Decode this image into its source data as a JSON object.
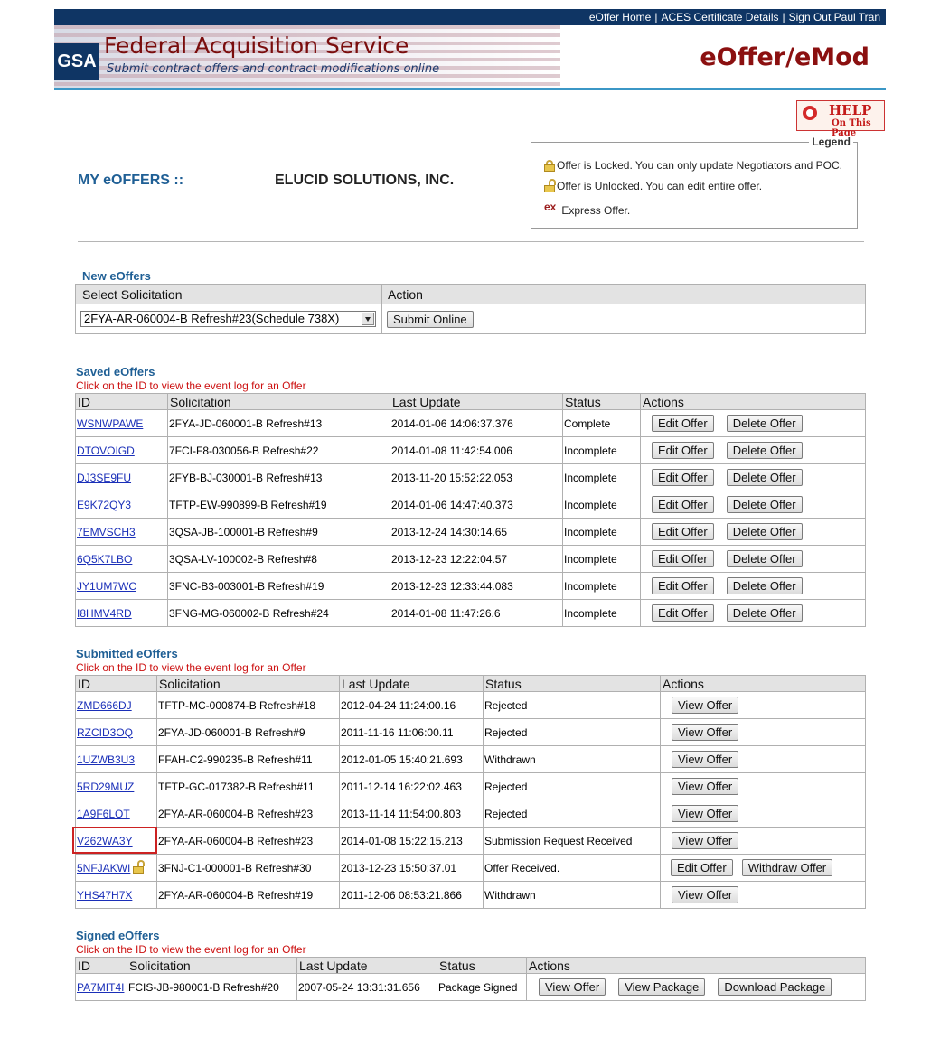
{
  "topnav": {
    "home": "eOffer Home",
    "aces": "ACES Certificate Details",
    "signout": "Sign Out Paul Tran",
    "sep": "|"
  },
  "header": {
    "logo": "GSA",
    "title": "Federal Acquisition Service",
    "subtitle": "Submit contract offers and contract modifications online",
    "app_title": "eOffer/eMod"
  },
  "help": {
    "main": "HELP",
    "sub": "On This Page",
    "icon": "lifebuoy-icon"
  },
  "legend": {
    "title": "Legend",
    "locked": "Offer is Locked. You can only update Negotiators and POC.",
    "unlocked": "Offer is Unlocked. You can edit entire offer.",
    "express_marker": "ex",
    "express": "Express Offer.",
    "lock_color": "#e8c64c"
  },
  "page": {
    "heading": "MY eOFFERS ::",
    "company": "ELUCID SOLUTIONS, INC."
  },
  "new_offers": {
    "title": "New eOffers",
    "col_select": "Select Solicitation",
    "col_action": "Action",
    "selected": "2FYA-AR-060004-B Refresh#23(Schedule 738X)",
    "submit": "Submit Online"
  },
  "hint": "Click on the ID to view the event log for an Offer",
  "saved": {
    "title": "Saved eOffers",
    "headers": [
      "ID",
      "Solicitation",
      "Last Update",
      "Status",
      "Actions"
    ],
    "edit": "Edit Offer",
    "delete": "Delete Offer",
    "rows": [
      {
        "id": "WSNWPAWE",
        "sol": "2FYA-JD-060001-B Refresh#13",
        "date": "2014-01-06 14:06:37.376",
        "status": "Complete"
      },
      {
        "id": "DTOVOIGD",
        "sol": "7FCI-F8-030056-B Refresh#22",
        "date": "2014-01-08 11:42:54.006",
        "status": "Incomplete"
      },
      {
        "id": "DJ3SE9FU",
        "sol": "2FYB-BJ-030001-B Refresh#13",
        "date": "2013-11-20 15:52:22.053",
        "status": "Incomplete"
      },
      {
        "id": "E9K72QY3",
        "sol": "TFTP-EW-990899-B Refresh#19",
        "date": "2014-01-06 14:47:40.373",
        "status": "Incomplete"
      },
      {
        "id": "7EMVSCH3",
        "sol": "3QSA-JB-100001-B Refresh#9",
        "date": "2013-12-24 14:30:14.65",
        "status": "Incomplete"
      },
      {
        "id": "6Q5K7LBO",
        "sol": "3QSA-LV-100002-B Refresh#8",
        "date": "2013-12-23 12:22:04.57",
        "status": "Incomplete"
      },
      {
        "id": "JY1UM7WC",
        "sol": "3FNC-B3-003001-B Refresh#19",
        "date": "2013-12-23 12:33:44.083",
        "status": "Incomplete"
      },
      {
        "id": "I8HMV4RD",
        "sol": "3FNG-MG-060002-B Refresh#24",
        "date": "2014-01-08 11:47:26.6",
        "status": "Incomplete"
      }
    ]
  },
  "submitted": {
    "title": "Submitted eOffers",
    "headers": [
      "ID",
      "Solicitation",
      "Last Update",
      "Status",
      "Actions"
    ],
    "view": "View Offer",
    "edit": "Edit Offer",
    "withdraw": "Withdraw Offer",
    "rows": [
      {
        "id": "ZMD666DJ",
        "sol": "TFTP-MC-000874-B Refresh#18",
        "date": "2012-04-24 11:24:00.16",
        "status": "Rejected"
      },
      {
        "id": "RZCID3OQ",
        "sol": "2FYA-JD-060001-B Refresh#9",
        "date": "2011-11-16 11:06:00.11",
        "status": "Rejected"
      },
      {
        "id": "1UZWB3U3",
        "sol": "FFAH-C2-990235-B Refresh#11",
        "date": "2012-01-05 15:40:21.693",
        "status": "Withdrawn"
      },
      {
        "id": "5RD29MUZ",
        "sol": "TFTP-GC-017382-B Refresh#11",
        "date": "2011-12-14 16:22:02.463",
        "status": "Rejected"
      },
      {
        "id": "1A9F6LOT",
        "sol": "2FYA-AR-060004-B Refresh#23",
        "date": "2013-11-14 11:54:00.803",
        "status": "Rejected"
      },
      {
        "id": "V262WA3Y",
        "sol": "2FYA-AR-060004-B Refresh#23",
        "date": "2014-01-08 15:22:15.213",
        "status": "Submission Request Received"
      },
      {
        "id": "5NFJAKWI",
        "sol": "3FNJ-C1-000001-B Refresh#30",
        "date": "2013-12-23 15:50:37.01",
        "status": "Offer Received."
      },
      {
        "id": "YHS47H7X",
        "sol": "2FYA-AR-060004-B Refresh#19",
        "date": "2011-12-06 08:53:21.866",
        "status": "Withdrawn"
      }
    ]
  },
  "signed": {
    "title": "Signed eOffers",
    "headers": [
      "ID",
      "Solicitation",
      "Last Update",
      "Status",
      "Actions"
    ],
    "view": "View Offer",
    "view_package": "View Package",
    "download_package": "Download Package",
    "rows": [
      {
        "id": "PA7MIT4I",
        "sol": "FCIS-JB-980001-B Refresh#20",
        "date": "2007-05-24 13:31:31.656",
        "status": "Package Signed"
      }
    ]
  }
}
